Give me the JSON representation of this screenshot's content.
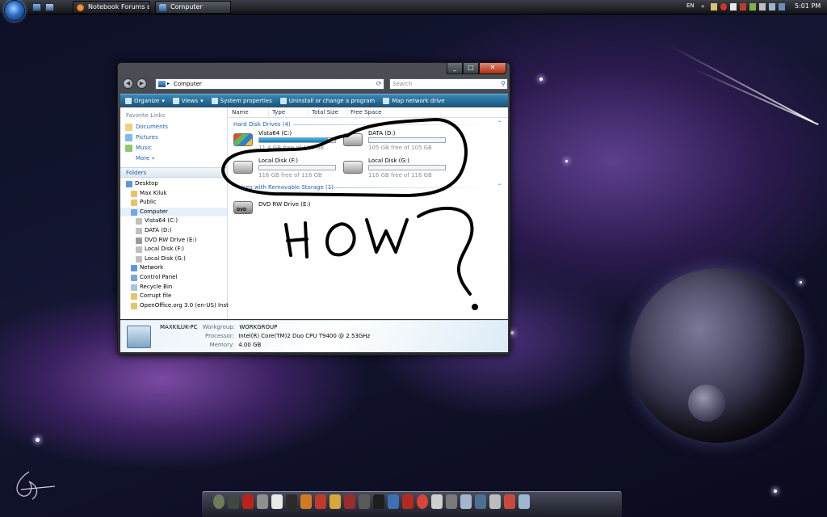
{
  "taskbar": {
    "tasks": [
      {
        "label": "Notebook Forums a...",
        "icon": "firefox-icon"
      },
      {
        "label": "Computer",
        "icon": "computer-icon"
      }
    ],
    "language": "EN",
    "clock": "5:01 PM"
  },
  "window": {
    "address": "Computer",
    "search_placeholder": "Search",
    "toolbar": [
      "Organize",
      "Views",
      "System properties",
      "Uninstall or change a program",
      "Map network drive"
    ],
    "favorite_links_title": "Favorite Links",
    "favorite_links": [
      "Documents",
      "Pictures",
      "Music",
      "More"
    ],
    "folders_title": "Folders",
    "tree": [
      "Desktop",
      "Max Kiluk",
      "Public",
      "Computer",
      "Vista64 (C:)",
      "DATA (D:)",
      "DVD RW Drive (E:)",
      "Local Disk (F:)",
      "Local Disk (G:)",
      "Network",
      "Control Panel",
      "Recycle Bin",
      "Corrupt file",
      "OpenOffice.org 3.0 (en-US) Inst"
    ],
    "columns": [
      "Name",
      "Type",
      "Total Size",
      "Free Space"
    ],
    "hdd_group": "Hard Disk Drives (4)",
    "removable_group": "ices with Removable Storage (1)",
    "drives": [
      {
        "name": "Vista64 (C:)",
        "free_text": "11.4 GB free of 116 GB",
        "used_fraction": 0.9
      },
      {
        "name": "DATA (D:)",
        "free_text": "105 GB free of 105 GB",
        "used_fraction": 0.0
      },
      {
        "name": "Local Disk (F:)",
        "free_text": "116 GB free of 116 GB",
        "used_fraction": 0.0
      },
      {
        "name": "Local Disk (G:)",
        "free_text": "116 GB free of 116 GB",
        "used_fraction": 0.0
      }
    ],
    "dvd": {
      "name": "DVD RW Drive (E:)",
      "icon_label": "DVD"
    },
    "details": {
      "computer_name": "MAXKILUK-PC",
      "workgroup_label": "Workgroup:",
      "workgroup": "WORKGROUP",
      "processor_label": "Processor:",
      "processor": "Intel(R) Core(TM)2 Duo CPU    T9400  @ 2.53GHz",
      "memory_label": "Memory:",
      "memory": "4.00 GB"
    }
  },
  "colors": {
    "explorer_toolbar": "#1f6a96",
    "link_blue": "#1e5fb3",
    "drive_fill": "#1479b7",
    "marker": "#000000"
  }
}
